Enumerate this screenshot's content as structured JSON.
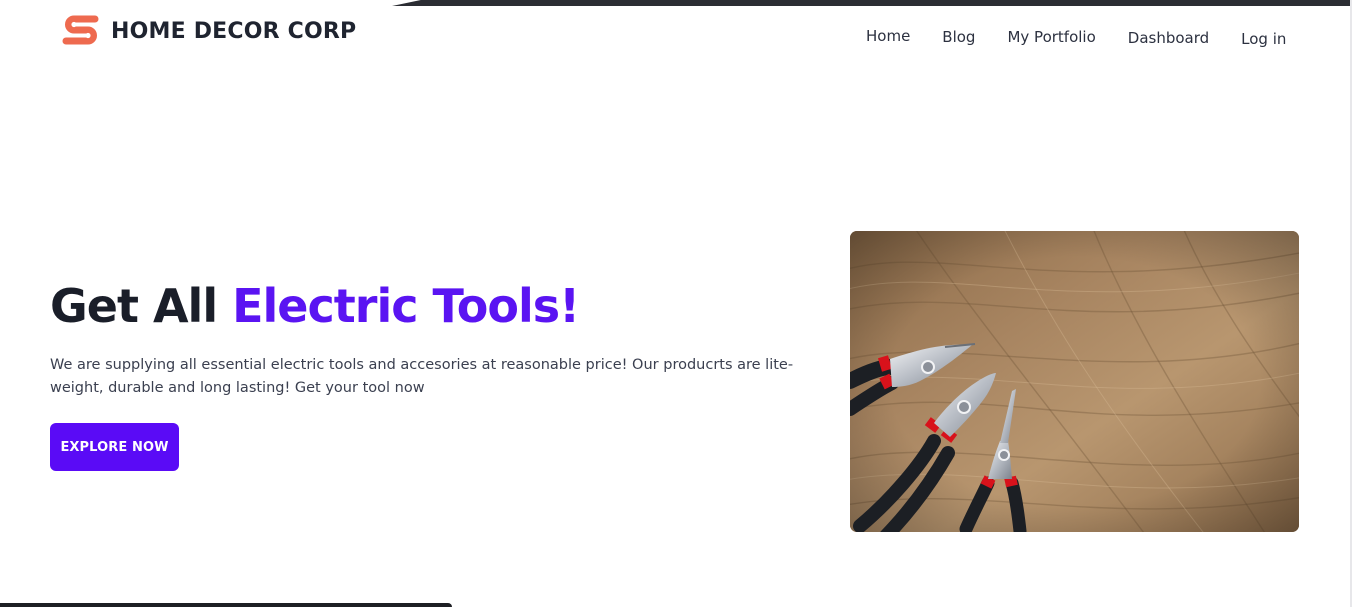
{
  "brand": {
    "name": "HOME DECOR CORP",
    "logo_icon": "brand-s-logo-icon",
    "logo_color": "#ee6a4f"
  },
  "nav": {
    "links": [
      "Home",
      "Blog",
      "My Portfolio",
      "Dashboard",
      "Log in"
    ]
  },
  "hero": {
    "title_prefix": "Get All ",
    "title_accent": "Electric Tools!",
    "description": "We are supplying all essential electric tools and accesories at reasonable price! Our producrts are lite-weight, durable and long lasting! Get your tool now",
    "cta_label": "EXPLORE NOW",
    "accent_color": "#5a14f2",
    "button_color": "#5a0bf6",
    "image_subject": "three-pliers-on-wooden-surface"
  }
}
